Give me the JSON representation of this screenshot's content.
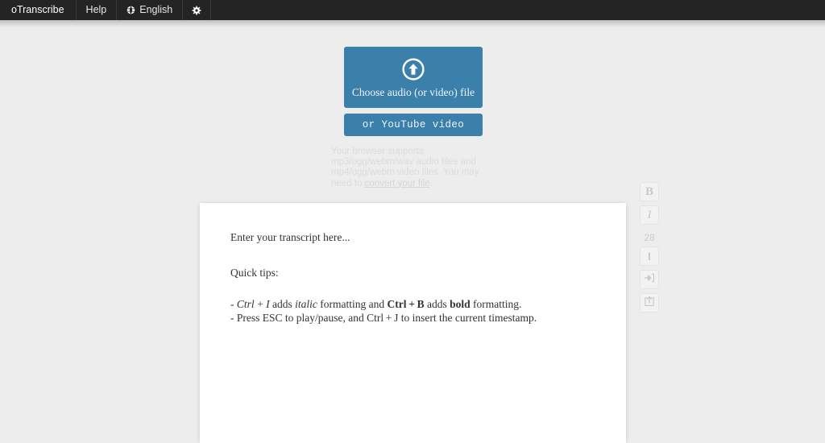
{
  "navbar": {
    "brand": "oTranscribe",
    "items": [
      {
        "label": "Help",
        "icon": null
      },
      {
        "label": "English",
        "icon": "globe-icon"
      },
      {
        "label": "",
        "icon": "gear-icon"
      }
    ]
  },
  "upload": {
    "choose_file_label": "Choose audio (or video) file",
    "choose_file_icon": "upload-arrow-circle-icon",
    "youtube_label": "or YouTube video",
    "support_text_before": "Your browser supports mp3/ogg/webm/wav audio files and mp4/ogg/webm video files. You may need to ",
    "support_link": "convert your file",
    "support_text_after": "."
  },
  "editor": {
    "placeholder": "Enter your transcript here...",
    "quick_tips_heading": "Quick tips:",
    "tips": [
      {
        "prefix": "- ",
        "k1": "Ctrl + I",
        "mid1": " adds ",
        "em1": "italic",
        "mid2": " formatting and ",
        "k2": "Ctrl + B",
        "mid3": " adds ",
        "em2": "bold",
        "suffix": " formatting."
      },
      {
        "text": "- Press ESC to play/pause, and Ctrl + J to insert the current timestamp."
      }
    ]
  },
  "toolbar": {
    "bold_label": "B",
    "italic_label": "I",
    "text_size_value": "28",
    "caret_label": "I",
    "import_icon": "sign-in-arrow-icon",
    "export_icon": "share-export-icon"
  },
  "colors": {
    "navbar_bg": "#242424",
    "accent_blue": "#3a80ab",
    "page_bg": "#ededed",
    "editor_bg": "#ffffff"
  }
}
